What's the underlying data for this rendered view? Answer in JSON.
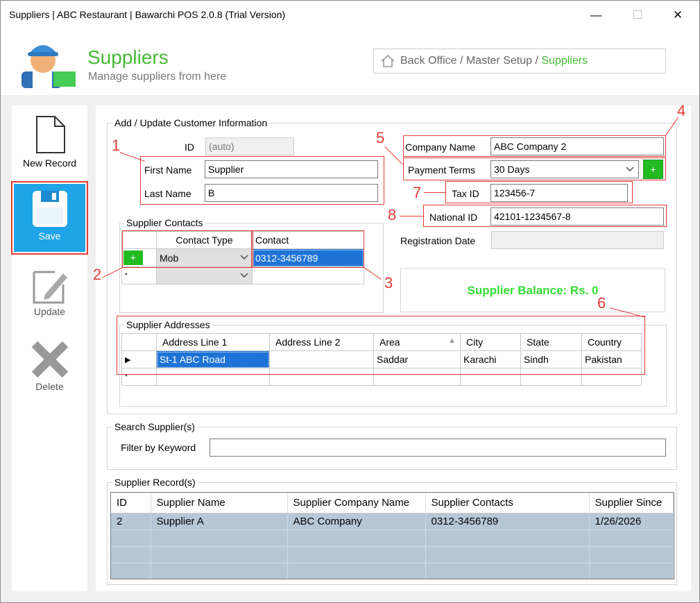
{
  "window": {
    "title": "Suppliers | ABC Restaurant | Bawarchi POS 2.0.8 (Trial Version)",
    "minimize": "—",
    "maximize": "☐",
    "close": "✕"
  },
  "header": {
    "title": "Suppliers",
    "subtitle": "Manage suppliers from here",
    "breadcrumb_prefix": "Back Office / Master Setup / ",
    "breadcrumb_current": "Suppliers"
  },
  "sidebar": {
    "new_label": "New Record",
    "save_label": "Save",
    "update_label": "Update",
    "delete_label": "Delete"
  },
  "form": {
    "group_label": "Add / Update Customer Information",
    "id_label": "ID",
    "id_value": "(auto)",
    "first_name_label": "First Name",
    "first_name": "Supplier",
    "last_name_label": "Last Name",
    "last_name": "B",
    "company_label": "Company Name",
    "company": "ABC Company 2",
    "terms_label": "Payment Terms",
    "terms": "30 Days",
    "add_btn": "+",
    "tax_label": "Tax ID",
    "tax": "123456-7",
    "national_label": "National ID",
    "national": "42101-1234567-8",
    "regdate_label": "Registration Date",
    "balance": "Supplier Balance: Rs. 0"
  },
  "contacts": {
    "group_label": "Supplier Contacts",
    "headers": [
      "Contact Type",
      "Contact"
    ],
    "row": {
      "type": "Mob",
      "contact": "0312-3456789"
    },
    "add_btn": "+",
    "new_row_marker": "*"
  },
  "addresses": {
    "group_label": "Supplier Addresses",
    "headers": [
      "Address Line 1",
      "Address Line 2",
      "Area",
      "City",
      "State",
      "Country"
    ],
    "row": [
      "St-1 ABC Road",
      "",
      "Saddar",
      "Karachi",
      "Sindh",
      "Pakistan"
    ],
    "row_marker": "▶",
    "new_row_marker": "*"
  },
  "search": {
    "group_label": "Search Supplier(s)",
    "filter_label": "Filter by Keyword",
    "value": ""
  },
  "records": {
    "group_label": "Supplier Record(s)",
    "headers": [
      "ID",
      "Supplier Name",
      "Supplier Company Name",
      "Supplier Contacts",
      "Supplier Since"
    ],
    "rows": [
      [
        "2",
        "Supplier A",
        "ABC Company",
        "0312-3456789",
        "1/26/2026"
      ]
    ]
  },
  "annotations": [
    "1",
    "2",
    "3",
    "4",
    "5",
    "6",
    "7",
    "8"
  ]
}
